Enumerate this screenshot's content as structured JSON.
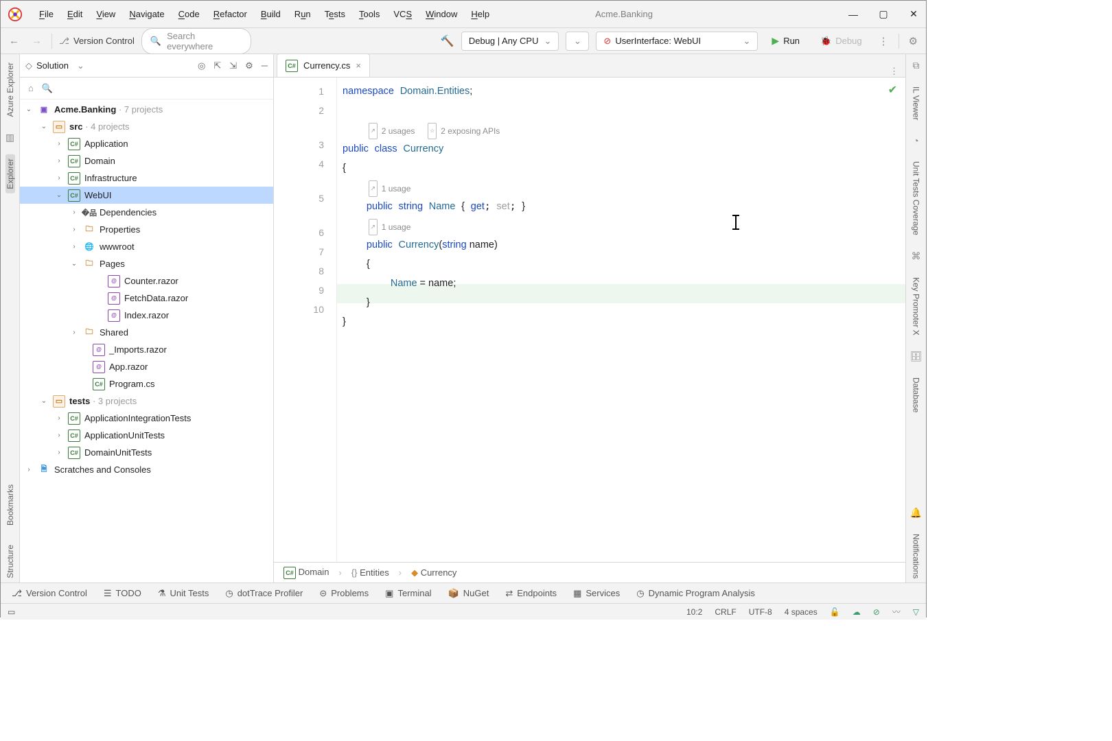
{
  "window": {
    "title": "Acme.Banking"
  },
  "menu": [
    "File",
    "Edit",
    "View",
    "Navigate",
    "Code",
    "Refactor",
    "Build",
    "Run",
    "Tests",
    "Tools",
    "VCS",
    "Window",
    "Help"
  ],
  "toolbar": {
    "vcs": "Version Control",
    "search_placeholder": "Search everywhere",
    "build_config": "Debug | Any CPU",
    "run_config": "UserInterface: WebUI",
    "run": "Run",
    "debug": "Debug"
  },
  "left_rail": [
    "Azure Explorer",
    "Explorer",
    "Bookmarks",
    "Structure"
  ],
  "right_rail": [
    "IL Viewer",
    "Unit Tests Coverage",
    "Key Promoter X",
    "Database",
    "Notifications"
  ],
  "explorer": {
    "title": "Solution",
    "root": {
      "name": "Acme.Banking",
      "suffix": "· 7 projects"
    },
    "src": {
      "name": "src",
      "suffix": "· 4 projects"
    },
    "projects": [
      "Application",
      "Domain",
      "Infrastructure",
      "WebUI"
    ],
    "webui_children": {
      "dependencies": "Dependencies",
      "properties": "Properties",
      "wwwroot": "wwwroot",
      "pages": "Pages",
      "shared": "Shared",
      "imports": "_Imports.razor",
      "app": "App.razor",
      "program": "Program.cs"
    },
    "pages": [
      "Counter.razor",
      "FetchData.razor",
      "Index.razor"
    ],
    "tests": {
      "name": "tests",
      "suffix": "· 3 projects"
    },
    "test_projects": [
      "ApplicationIntegrationTests",
      "ApplicationUnitTests",
      "DomainUnitTests"
    ],
    "scratches": "Scratches and Consoles"
  },
  "tab": {
    "label": "Currency.cs"
  },
  "code": {
    "l1_a": "namespace",
    "l1_b": "Domain.Entities",
    "l1_c": ";",
    "hint1_a": "2 usages",
    "hint1_b": "2 exposing APIs",
    "l3_a": "public",
    "l3_b": "class",
    "l3_c": "Currency",
    "l4": "{",
    "hint2": "1 usage",
    "l5_a": "public",
    "l5_b": "string",
    "l5_c": "Name",
    "l5_d": "{",
    "l5_get": "get",
    "l5_set": "set",
    "l5_e": "}",
    "hint3": "1 usage",
    "l6_a": "public",
    "l6_b": "Currency",
    "l6_c": "(",
    "l6_d": "string",
    "l6_e": " name)",
    "l7": "{",
    "l8_a": "Name",
    "l8_b": " = name;",
    "l9": "}",
    "l10": "}",
    "line_numbers": [
      "1",
      "2",
      "3",
      "4",
      "5",
      "6",
      "7",
      "8",
      "9",
      "10"
    ]
  },
  "breadcrumbs": [
    "Domain",
    "Entities",
    "Currency"
  ],
  "bottom_tools": [
    "Version Control",
    "TODO",
    "Unit Tests",
    "dotTrace Profiler",
    "Problems",
    "Terminal",
    "NuGet",
    "Endpoints",
    "Services",
    "Dynamic Program Analysis"
  ],
  "status": {
    "pos": "10:2",
    "eol": "CRLF",
    "enc": "UTF-8",
    "indent": "4 spaces"
  }
}
